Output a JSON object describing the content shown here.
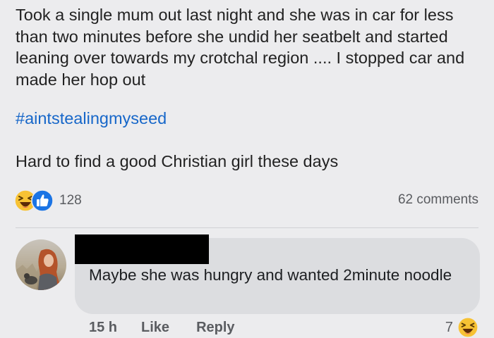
{
  "post": {
    "text": "Took a single mum out last night and she was in car for less than two minutes before she undid her seatbelt and started leaning over towards my crotchal region .... I stopped car and made her hop out",
    "hashtag": "#aintstealingmyseed",
    "text2": "Hard to find a good Christian girl these days",
    "reaction_icons": [
      "laughing-emoji-icon",
      "thumbs-up-icon"
    ],
    "reaction_count": "128",
    "comments_count": "62 comments"
  },
  "comment": {
    "text": "Maybe she was hungry and wanted 2minute noodle",
    "time": "15 h",
    "like_label": "Like",
    "reply_label": "Reply",
    "reaction_count": "7",
    "reaction_icon": "laughing-emoji-icon"
  },
  "colors": {
    "background": "#ececee",
    "hashtag": "#1767c9",
    "bubble": "#dcdde0",
    "secondary_text": "#5a5c60"
  }
}
